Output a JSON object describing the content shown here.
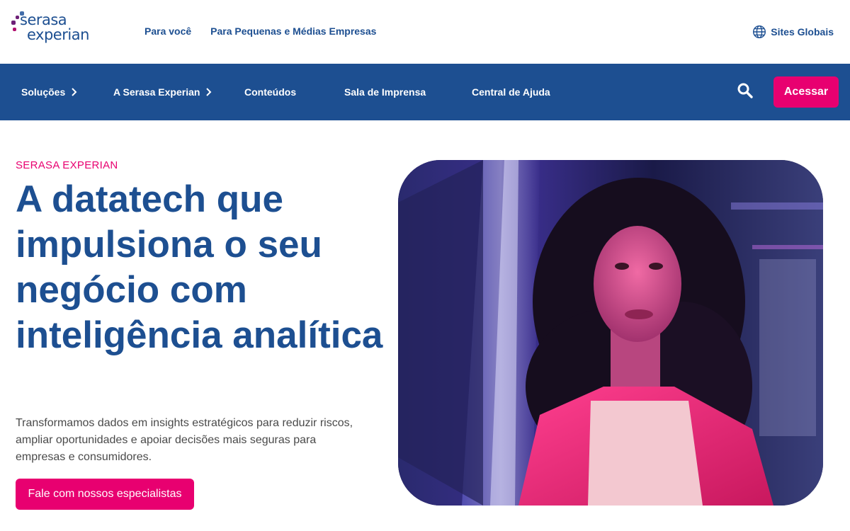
{
  "brand": {
    "logo_line1": "serasa",
    "logo_line2": "experian",
    "colors": {
      "primary": "#1d4f91",
      "accent": "#e80070",
      "logo_purple": "#6d2077",
      "logo_blue": "#426da9",
      "logo_magenta": "#b10f6d"
    }
  },
  "top_nav": {
    "links": [
      {
        "label": "Para você"
      },
      {
        "label": "Para Pequenas e Médias Empresas"
      }
    ],
    "global_sites": {
      "label": "Sites Globais",
      "icon": "globe-icon"
    }
  },
  "main_nav": {
    "items": [
      {
        "label": "Soluções",
        "has_chevron": true
      },
      {
        "label": "A Serasa Experian",
        "has_chevron": true
      },
      {
        "label": "Conteúdos",
        "has_chevron": false
      },
      {
        "label": "Sala de Imprensa",
        "has_chevron": false
      },
      {
        "label": "Central de Ajuda",
        "has_chevron": false
      }
    ],
    "search_icon": "search-icon",
    "login_button": "Acessar"
  },
  "hero": {
    "eyebrow": "SERASA EXPERIAN",
    "headline": "A datatech que impulsiona o seu negócio com inteligência analítica",
    "description": "Transformamos dados em insights estratégicos para reduzir riscos, ampliar oportunidades e apoiar decisões mais seguras para empresas e consumidores.",
    "cta": "Fale com nossos especialistas"
  }
}
